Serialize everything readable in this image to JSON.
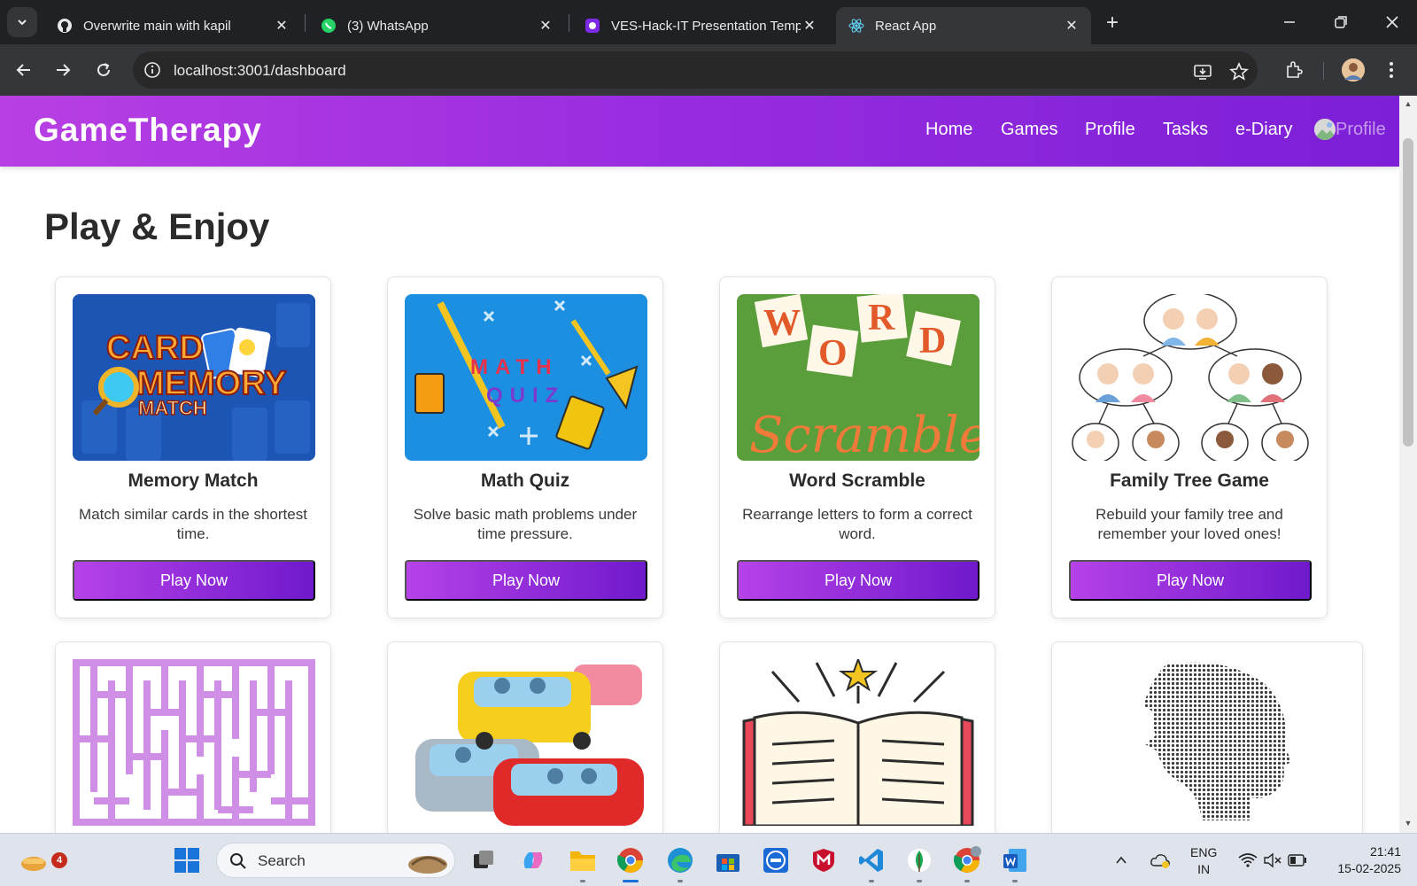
{
  "browser": {
    "tabs": [
      {
        "title": "Overwrite main with kapil",
        "icon": "github-icon",
        "active": false
      },
      {
        "title": "(3) WhatsApp",
        "icon": "whatsapp-icon",
        "active": false
      },
      {
        "title": "VES-Hack-IT Presentation Temp",
        "icon": "canva-icon",
        "active": false
      },
      {
        "title": "React App",
        "icon": "react-icon",
        "active": true
      }
    ],
    "url": "localhost:3001/dashboard"
  },
  "app": {
    "brand": "GameTherapy",
    "nav": [
      {
        "label": "Home"
      },
      {
        "label": "Games"
      },
      {
        "label": "Profile"
      },
      {
        "label": "Tasks"
      },
      {
        "label": "e-Diary"
      }
    ],
    "avatar_alt": "Profile",
    "heading": "Play & Enjoy",
    "games": [
      {
        "title": "Memory Match",
        "description": "Match similar cards in the shortest time.",
        "button": "Play Now",
        "image_text": [
          "CARD",
          "MEMORY",
          "MATCH"
        ]
      },
      {
        "title": "Math Quiz",
        "description": "Solve basic math problems under time pressure.",
        "button": "Play Now",
        "image_text": [
          "MATH",
          "QUIZ"
        ]
      },
      {
        "title": "Word Scramble",
        "description": "Rearrange letters to form a correct word.",
        "button": "Play Now",
        "image_text": [
          "W",
          "O",
          "R",
          "D",
          "Scramble"
        ]
      },
      {
        "title": "Family Tree Game",
        "description": "Rebuild your family tree and remember your loved ones!",
        "button": "Play Now"
      },
      {
        "image": "maze"
      },
      {
        "image": "traffic-cars"
      },
      {
        "image": "open-book"
      },
      {
        "image": "dotted-head-profile"
      }
    ]
  },
  "taskbar": {
    "widgets_badge": "4",
    "search_placeholder": "Search",
    "language_line1": "ENG",
    "language_line2": "IN",
    "time": "21:41",
    "date": "15-02-2025"
  },
  "colors": {
    "header_gradient_start": "#b83fe3",
    "header_gradient_end": "#7c1fd6",
    "button_gradient_start": "#b642e8",
    "button_gradient_end": "#6f19cc"
  }
}
